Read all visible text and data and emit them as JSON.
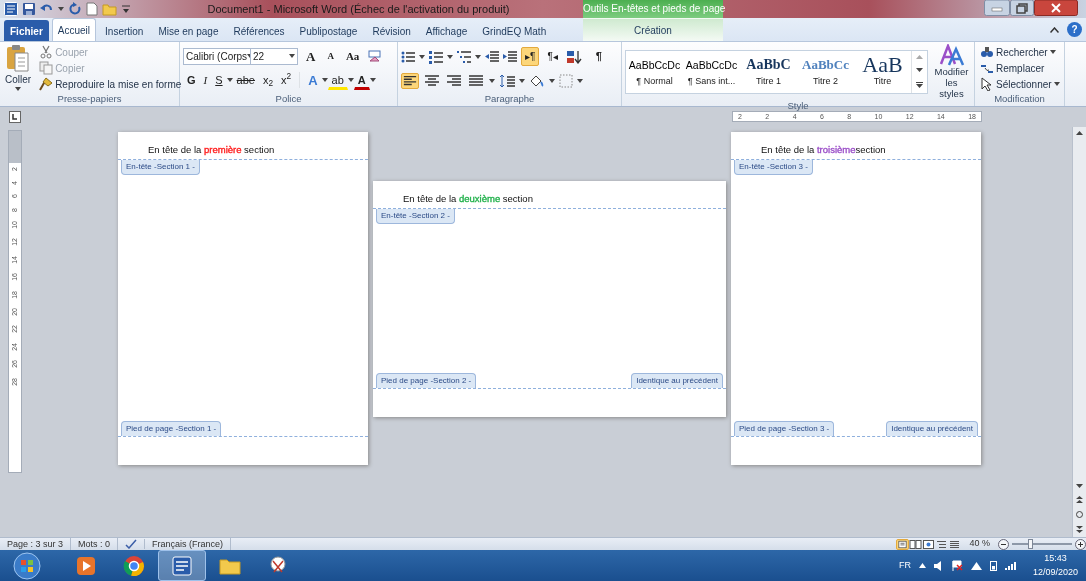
{
  "title_bar": {
    "title": "Document1  -  Microsoft Word (Échec de l'activation du produit)",
    "context_label": "Outils En-têtes et pieds de page"
  },
  "tabs": [
    {
      "label": "Fichier",
      "kind": "file",
      "selected": false
    },
    {
      "label": "Accueil",
      "kind": "normal",
      "selected": true
    },
    {
      "label": "Insertion",
      "kind": "normal",
      "selected": false
    },
    {
      "label": "Mise en page",
      "kind": "normal",
      "selected": false
    },
    {
      "label": "Références",
      "kind": "normal",
      "selected": false
    },
    {
      "label": "Publipostage",
      "kind": "normal",
      "selected": false
    },
    {
      "label": "Révision",
      "kind": "normal",
      "selected": false
    },
    {
      "label": "Affichage",
      "kind": "normal",
      "selected": false
    },
    {
      "label": "GrindEQ Math",
      "kind": "normal",
      "selected": false
    },
    {
      "label": "Création",
      "kind": "contextual",
      "selected": false
    }
  ],
  "help": "?",
  "clipboard": {
    "label": "Presse-papiers",
    "paste": "Coller",
    "commands": [
      {
        "label": "Couper",
        "kind": "cut",
        "disabled": true
      },
      {
        "label": "Copier",
        "kind": "copy",
        "disabled": true
      },
      {
        "label": "Reproduire la mise en forme",
        "kind": "painter",
        "disabled": false
      }
    ]
  },
  "font": {
    "label": "Police",
    "font_name": "Calibri (Corps",
    "font_size": "22",
    "size_buttons": [
      {
        "label": "A",
        "kind": "grow"
      },
      {
        "label": "A",
        "kind": "shrink"
      },
      {
        "label": "Aa",
        "kind": "case"
      }
    ],
    "format_buttons": [
      {
        "label": "G",
        "kind": "bold"
      },
      {
        "label": "I",
        "kind": "italic"
      },
      {
        "label": "S",
        "kind": "underline"
      },
      {
        "label": "abe",
        "kind": "strike"
      },
      {
        "label": "x$_{2}$",
        "kind": "subscript"
      },
      {
        "label": "x$^{2}$",
        "kind": "superscript"
      }
    ],
    "effect_buttons": [
      {
        "label": "A",
        "kind": "effects"
      },
      {
        "label": "ab",
        "kind": "highlight"
      },
      {
        "label": "A",
        "kind": "color"
      }
    ]
  },
  "paragraph": {
    "label": "Paragraphe",
    "pilcrow": "¶",
    "direction": [
      {
        "label": "▸¶",
        "selected": true
      },
      {
        "label": "¶◂",
        "selected": false
      }
    ],
    "align": [
      {
        "kind": "left",
        "selected": true
      },
      {
        "kind": "center",
        "selected": false
      },
      {
        "kind": "right",
        "selected": false
      },
      {
        "kind": "justify",
        "selected": false
      }
    ]
  },
  "styles": {
    "label": "Style",
    "change": "Modifier les styles",
    "items": [
      {
        "preview": "AaBbCcDc",
        "name": "¶ Normal",
        "kind": "normal"
      },
      {
        "preview": "AaBbCcDc",
        "name": "¶ Sans int...",
        "kind": "normal"
      },
      {
        "preview": "AaBbC",
        "name": "Titre 1",
        "kind": "heading1"
      },
      {
        "preview": "AaBbCc",
        "name": "Titre 2",
        "kind": "heading2"
      },
      {
        "preview": "AaB",
        "name": "Titre",
        "kind": "title"
      }
    ]
  },
  "editing": {
    "label": "Modification",
    "commands": [
      {
        "label": "Rechercher",
        "kind": "find"
      },
      {
        "label": "Remplacer",
        "kind": "replace"
      },
      {
        "label": "Sélectionner",
        "kind": "select"
      }
    ]
  },
  "ruler": [
    "2",
    "2",
    "4",
    "6",
    "8",
    "10",
    "12",
    "14",
    "18"
  ],
  "vertical_ruler": [
    "2",
    "4",
    "6",
    "8",
    "10",
    "12",
    "14",
    "16",
    "18",
    "20",
    "22",
    "24",
    "26",
    "28"
  ],
  "pages": [
    {
      "kind": "portrait",
      "header": {
        "before": "En tête de la ",
        "highlight": "première",
        "color": "#ff2020",
        "after": " section"
      },
      "header_tag": "En-tête -Section 1 -",
      "footer_tag": "Pied de page -Section 1 -"
    },
    {
      "kind": "landscape",
      "header": {
        "before": "En tête de la ",
        "highlight": "deuxième",
        "color": "#22b14c",
        "after": " section"
      },
      "header_tag": "En-tête -Section 2 -",
      "footer_tag": "Pied de page -Section 2 -",
      "link_tag": "Identique au précédent"
    },
    {
      "kind": "portrait",
      "header": {
        "before": "En tête de la ",
        "highlight": "troisième",
        "color": "#9b4fc8",
        "after": "section"
      },
      "header_tag": "En-tête -Section 3 -",
      "footer_tag": "Pied de page -Section 3 -",
      "link_tag": "Identique au précédent"
    }
  ],
  "status_bar": {
    "page": "Page : 3 sur 3",
    "words": "Mots : 0",
    "language": "Français (France)",
    "views": [
      {
        "kind": "print",
        "selected": true
      },
      {
        "kind": "reading",
        "selected": false
      },
      {
        "kind": "web",
        "selected": false
      },
      {
        "kind": "outline",
        "selected": false
      },
      {
        "kind": "draft",
        "selected": false
      }
    ],
    "zoom": "40 %",
    "zoom_slider": {
      "level": 0.3
    }
  },
  "taskbar": {
    "apps": [
      {
        "kind": "media",
        "selected": false
      },
      {
        "kind": "chrome",
        "selected": false
      },
      {
        "kind": "word",
        "selected": true
      },
      {
        "kind": "explorer",
        "selected": false
      },
      {
        "kind": "snipping",
        "selected": false
      }
    ],
    "language": "FR",
    "time": "15:43",
    "date": "12/09/2020"
  }
}
